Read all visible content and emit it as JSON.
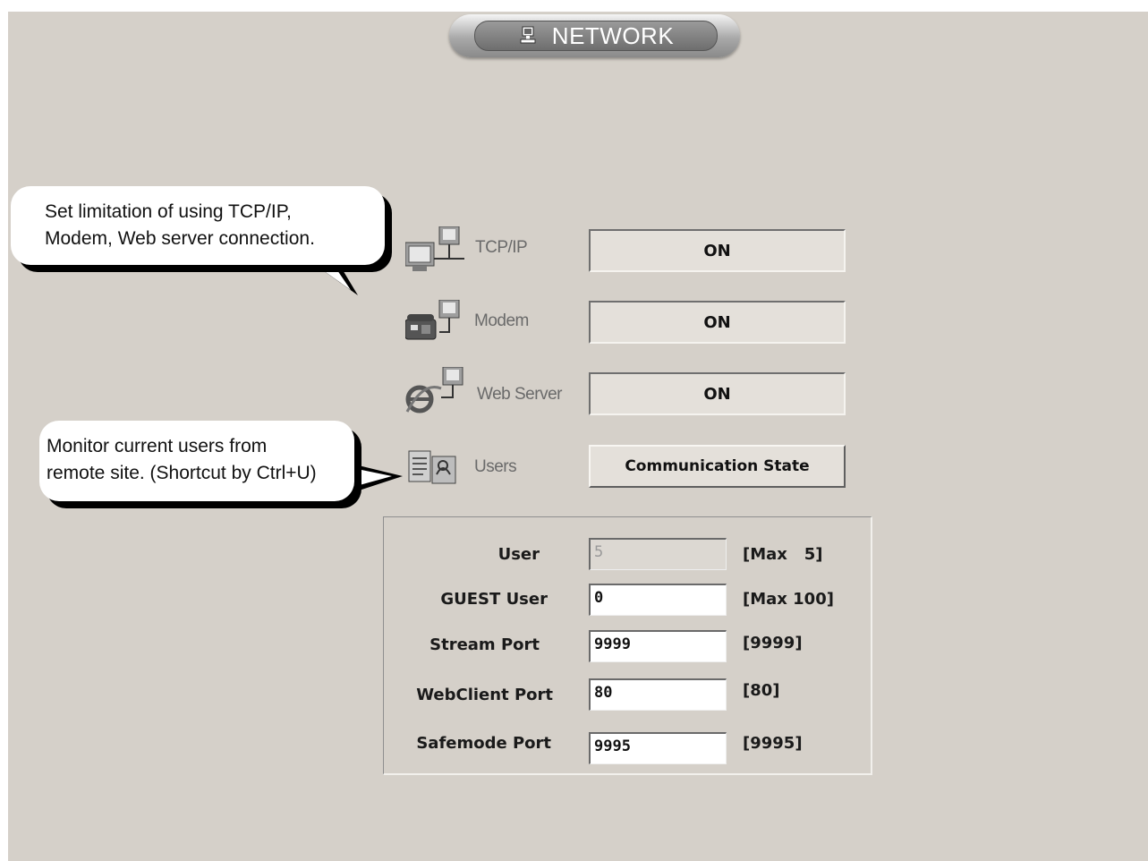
{
  "header": {
    "title": "NETWORK",
    "icon": "network-computer-icon"
  },
  "callouts": {
    "connection": {
      "line1": "Set limitation of using TCP/IP,",
      "line2": "Modem, Web server connection."
    },
    "users": {
      "line1": "Monitor current users from",
      "line2": "remote site. (Shortcut by Ctrl+U)"
    }
  },
  "connections": [
    {
      "label": "TCP/IP",
      "icon": "tcpip-computer-icon",
      "state": "ON"
    },
    {
      "label": "Modem",
      "icon": "modem-phone-icon",
      "state": "ON"
    },
    {
      "label": "Web Server",
      "icon": "web-server-ie-icon",
      "state": "ON"
    }
  ],
  "users": {
    "label": "Users",
    "icon": "users-document-icon",
    "button": "Communication State"
  },
  "settings": {
    "user": {
      "label": "User",
      "value": "5",
      "hint": "[Max   5]",
      "disabled": true
    },
    "guest_user": {
      "label": "GUEST User",
      "value": "0",
      "hint": "[Max 100]"
    },
    "stream_port": {
      "label": "Stream Port",
      "value": "9999",
      "hint": "[9999]"
    },
    "webclient_port": {
      "label": "WebClient Port",
      "value": "80",
      "hint": "[80]"
    },
    "safemode_port": {
      "label": "Safemode Port",
      "value": "9995",
      "hint": "[9995]"
    }
  },
  "colors": {
    "background": "#d5d0c9",
    "button_face": "#e4e0da",
    "label_gray": "#6a6a6a"
  }
}
